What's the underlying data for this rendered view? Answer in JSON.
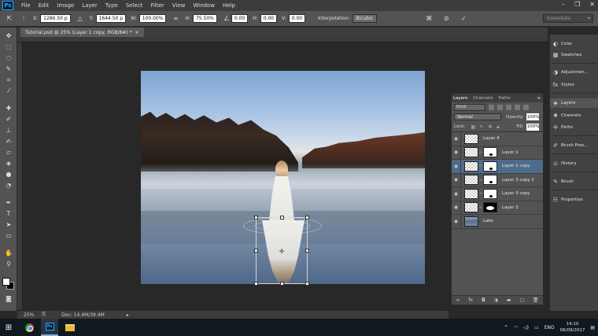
{
  "app": {
    "logo": "Ps",
    "menu": [
      "File",
      "Edit",
      "Image",
      "Layer",
      "Type",
      "Select",
      "Filter",
      "View",
      "Window",
      "Help"
    ],
    "window_controls": [
      "–",
      "❐",
      "✕"
    ]
  },
  "options_bar": {
    "x_label": "X:",
    "x_value": "1286.50 p",
    "y_label": "Y:",
    "y_value": "1644.50 p",
    "w_label": "W:",
    "w_value": "100.00%",
    "h_label": "H:",
    "h_value": "75.50%",
    "angle_value": "0.00",
    "hskew_label": "H:",
    "hskew_value": "0.00",
    "vskew_label": "V:",
    "vskew_value": "0.00",
    "interpolation_label": "Interpolation:",
    "interpolation_value": "Bicubic",
    "workspace": "Essentials"
  },
  "document_tab": {
    "title": "Tutorial.psd @ 25% (Layer 1 copy, RGB/8#) *",
    "close": "×"
  },
  "status_bar": {
    "zoom": "25%",
    "doc_size": "Doc: 14.4M/39.4M"
  },
  "layers_panel": {
    "tabs": [
      "Layers",
      "Channels",
      "Paths"
    ],
    "kind": "Kind",
    "blend_mode": "Normal",
    "opacity_label": "Opacity:",
    "opacity_value": "100%",
    "lock_label": "Lock:",
    "fill_label": "Fill:",
    "fill_value": "100%",
    "layers": [
      {
        "name": "Layer 4",
        "mask": "none",
        "selected": false
      },
      {
        "name": "Layer 1",
        "mask": "white",
        "selected": false
      },
      {
        "name": "Layer 1 copy",
        "mask": "white",
        "selected": true
      },
      {
        "name": "Layer 3 copy 2",
        "mask": "white",
        "selected": false
      },
      {
        "name": "Layer 3 copy",
        "mask": "white",
        "selected": false
      },
      {
        "name": "Layer 3",
        "mask": "black",
        "selected": false
      },
      {
        "name": "Lake",
        "mask": "none",
        "selected": false
      }
    ]
  },
  "dock": {
    "items": [
      "Color",
      "Swatches",
      "Adjustmen...",
      "Styles",
      "Layers",
      "Channels",
      "Paths",
      "Brush Pres...",
      "History",
      "Brush",
      "Properties"
    ]
  },
  "taskbar": {
    "language": "ENG",
    "time": "14:10",
    "date": "06/09/2017"
  }
}
